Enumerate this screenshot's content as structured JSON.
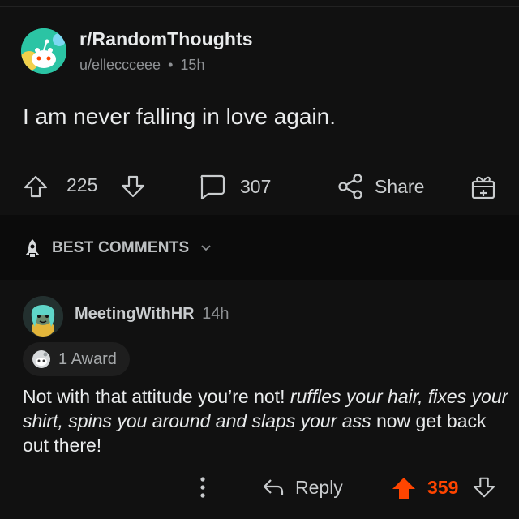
{
  "post": {
    "subreddit": "r/RandomThoughts",
    "author": "u/elleccceee",
    "separator": "•",
    "age": "15h",
    "title": "I am never falling in love again.",
    "upvotes": "225",
    "comments": "307",
    "share_label": "Share"
  },
  "comments_header": {
    "sort_label": "BEST COMMENTS"
  },
  "comment": {
    "author": "MeetingWithHR",
    "age": "14h",
    "award_label": "1 Award",
    "body_plain": "Not with that attitude you’re not! ",
    "body_italic": "ruffles your hair, fixes your shirt, spins you around and slaps your ass",
    "body_tail": " now get back out there!",
    "reply_label": "Reply",
    "score": "359"
  },
  "colors": {
    "upvote_active": "#ff4500",
    "background": "#0b0b0b",
    "card": "#111111"
  },
  "icons": [
    "snoo-avatar",
    "upvote-icon",
    "downvote-icon",
    "comment-icon",
    "share-icon",
    "gift-icon",
    "rocket-icon",
    "chevron-down-icon",
    "award-icon",
    "more-icon",
    "reply-icon"
  ]
}
